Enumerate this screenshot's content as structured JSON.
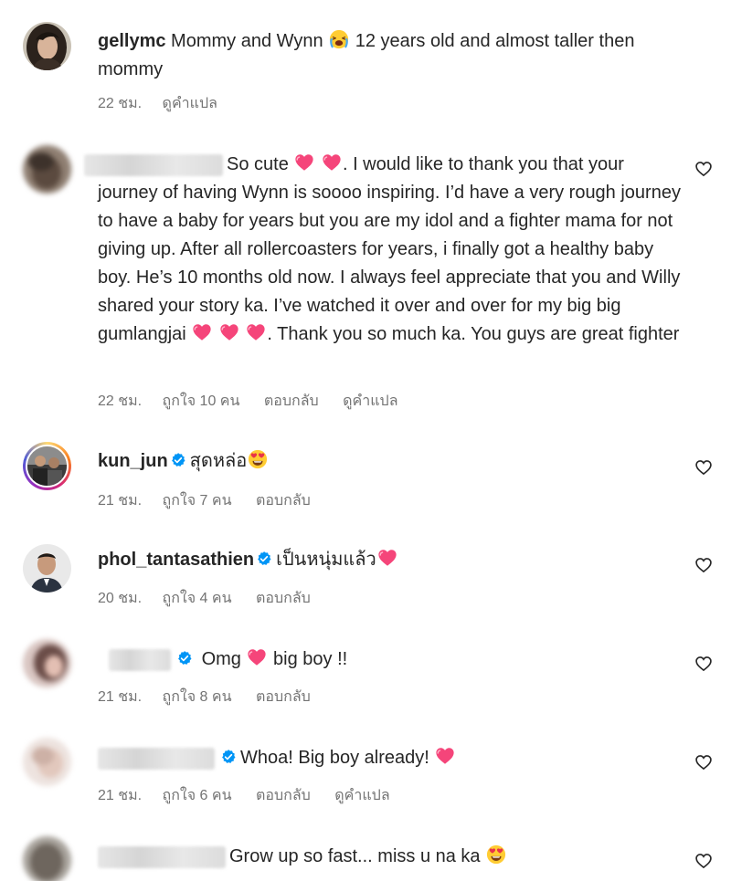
{
  "comments": [
    {
      "username": "gellymc",
      "text_before": "Mommy and Wynn",
      "text_after": "12 years old and almost taller then mommy",
      "time": "22 ชม.",
      "see_translation": "ดูคำแปล"
    },
    {
      "text_1": "So cute",
      "text_2": ". I would like to thank you that your journey of having Wynn is soooo inspiring. I’d have a very rough journey to have a baby for years but you are my idol and a fighter mama for not giving up. After all rollercoasters for years, i finally got a healthy baby boy. He’s 10 months old now. I always feel appreciate that you and Willy shared your story ka. I’ve watched it over and over for my big big gumlangjai",
      "text_3": ". Thank you so much ka. You guys are great fighter",
      "time": "22 ชม.",
      "likes": "ถูกใจ 10 คน",
      "reply": "ตอบกลับ",
      "see_translation": "ดูคำแปล"
    },
    {
      "username": "kun_jun",
      "text": "สุดหล่อ",
      "time": "21 ชม.",
      "likes": "ถูกใจ 7 คน",
      "reply": "ตอบกลับ"
    },
    {
      "username": "phol_tantasathien",
      "text": "เป็นหนุ่มแล้ว",
      "time": "20 ชม.",
      "likes": "ถูกใจ 4 คน",
      "reply": "ตอบกลับ"
    },
    {
      "text_1": "Omg",
      "text_2": "big boy !!",
      "time": "21 ชม.",
      "likes": "ถูกใจ 8 คน",
      "reply": "ตอบกลับ"
    },
    {
      "text": "Whoa! Big boy already!",
      "time": "21 ชม.",
      "likes": "ถูกใจ 6 คน",
      "reply": "ตอบกลับ",
      "see_translation": "ดูคำแปล"
    },
    {
      "text": "Grow up so fast... miss u na ka"
    }
  ],
  "icons": {
    "like": "heart-outline-icon",
    "verified": "verified-badge-icon",
    "heart_emoji": "pink-heart-emoji",
    "heart_eyes_emoji": "heart-eyes-emoji",
    "crying_emoji": "loudly-crying-emoji"
  },
  "colors": {
    "username": "#262626",
    "meta": "#737373",
    "verified": "#0095f6",
    "heart_emoji": "#f5457a"
  }
}
